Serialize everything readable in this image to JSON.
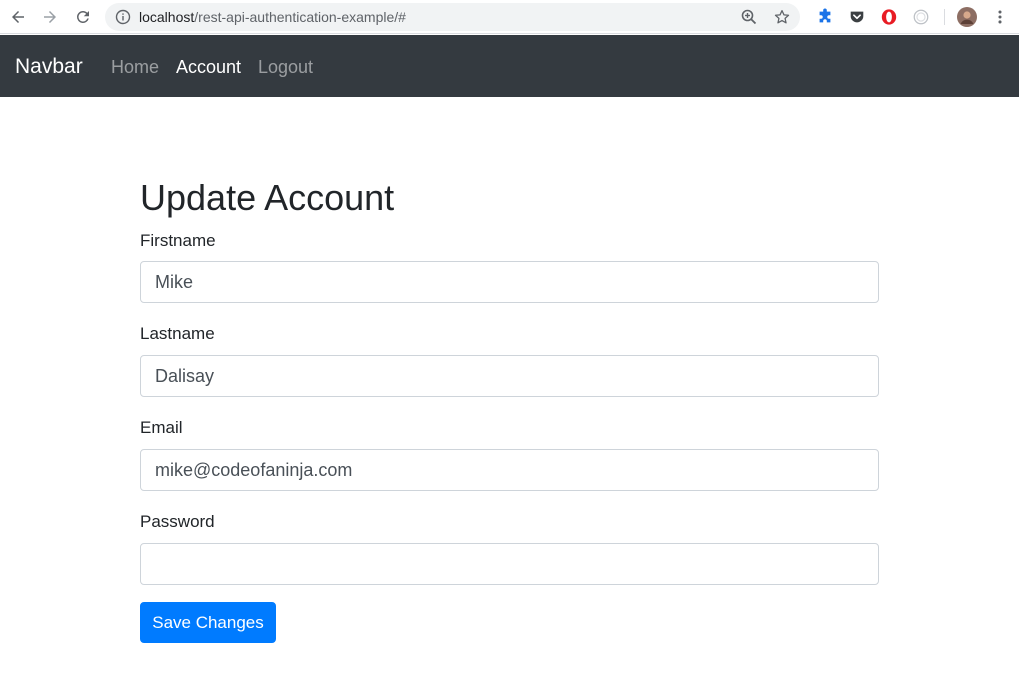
{
  "browser": {
    "url_host": "localhost",
    "url_path": "/rest-api-authentication-example/#"
  },
  "navbar": {
    "brand": "Navbar",
    "links": [
      {
        "label": "Home",
        "state": "inactive"
      },
      {
        "label": "Account",
        "state": "active"
      },
      {
        "label": "Logout",
        "state": "inactive"
      }
    ]
  },
  "form": {
    "title": "Update Account",
    "fields": [
      {
        "label": "Firstname",
        "value": "Mike"
      },
      {
        "label": "Lastname",
        "value": "Dalisay"
      },
      {
        "label": "Email",
        "value": "mike@codeofaninja.com"
      },
      {
        "label": "Password",
        "value": ""
      }
    ],
    "submit_label": "Save Changes"
  },
  "colors": {
    "navbar_bg": "#343a40",
    "primary": "#007bff",
    "text": "#212529"
  },
  "icons": [
    "back-arrow-icon",
    "forward-arrow-icon",
    "reload-icon",
    "info-icon",
    "zoom-icon",
    "star-icon",
    "puzzle-extension-icon",
    "pocket-extension-icon",
    "opera-extension-icon",
    "circle-extension-icon",
    "profile-avatar",
    "more-vert-icon"
  ]
}
